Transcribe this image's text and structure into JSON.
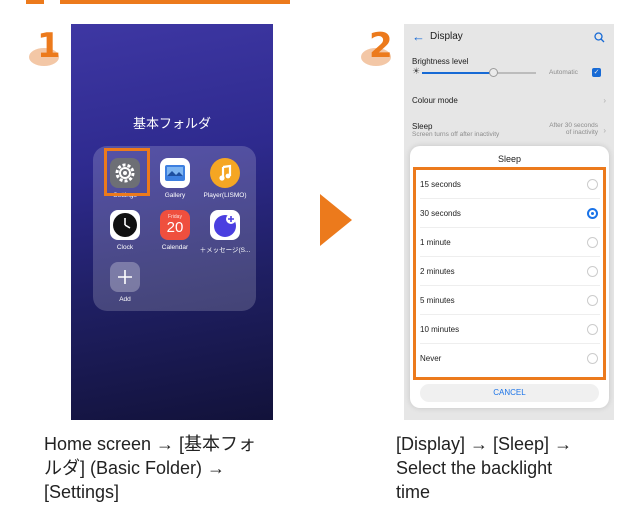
{
  "step1": {
    "number": "1",
    "folder_title": "基本フォルダ",
    "apps": [
      {
        "label": "Settings",
        "icon": "settings-gear-icon"
      },
      {
        "label": "Gallery",
        "icon": "gallery-icon"
      },
      {
        "label": "Player(LISMO)",
        "icon": "music-player-icon"
      },
      {
        "label": "Clock",
        "icon": "clock-icon"
      },
      {
        "label": "Calendar",
        "icon": "calendar-icon",
        "day_name": "Friday",
        "day_number": "20"
      },
      {
        "label": "＋メッセージ(S...",
        "icon": "message-icon"
      },
      {
        "label": "Add",
        "icon": "add-plus-icon"
      }
    ],
    "caption": "Home screen → [基本フォ\nルダ] (Basic Folder) →\n[Settings]"
  },
  "step2": {
    "number": "2",
    "screen_title": "Display",
    "brightness_label": "Brightness level",
    "brightness_level": 0.62,
    "automatic_label": "Automatic",
    "automatic_checked": true,
    "colour_mode_label": "Colour mode",
    "sleep_label": "Sleep",
    "sleep_value_1": "After 30 seconds",
    "sleep_value_2": "of inactivity",
    "sleep_sub": "Screen turns off after inactivity",
    "dialog_title": "Sleep",
    "options": [
      {
        "label": "15 seconds",
        "selected": false
      },
      {
        "label": "30 seconds",
        "selected": true
      },
      {
        "label": "1 minute",
        "selected": false
      },
      {
        "label": "2 minutes",
        "selected": false
      },
      {
        "label": "5 minutes",
        "selected": false
      },
      {
        "label": "10 minutes",
        "selected": false
      },
      {
        "label": "Never",
        "selected": false
      }
    ],
    "cancel_label": "CANCEL",
    "caption": "[Display] → [Sleep] →\nSelect the backlight\ntime"
  },
  "colors": {
    "accent": "#ec7a1c",
    "link_blue": "#1a73e8"
  }
}
